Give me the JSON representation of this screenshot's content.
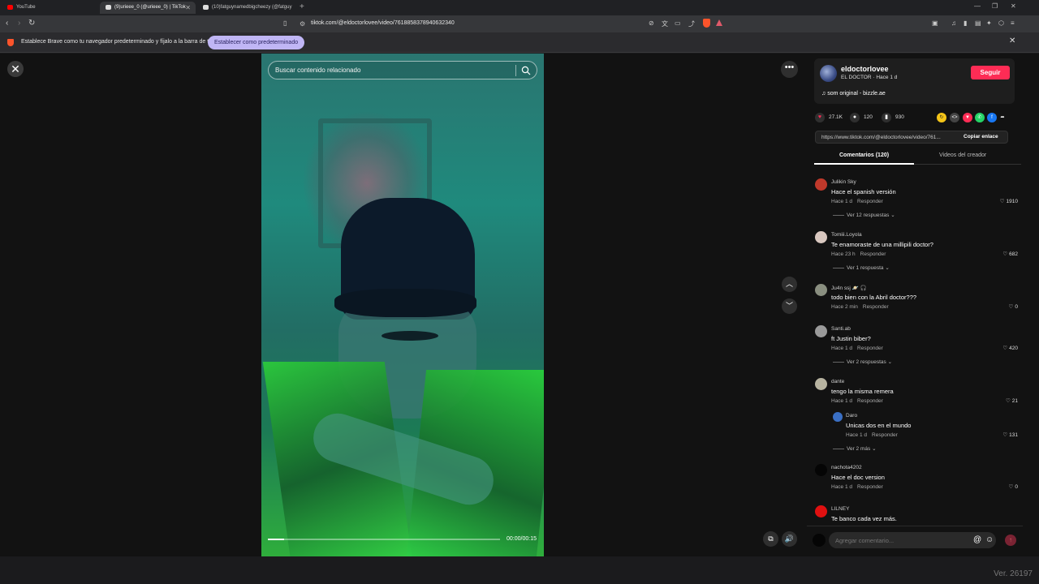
{
  "browser": {
    "tabs": [
      {
        "label": "YouTube",
        "color": "#ff0000"
      },
      {
        "label": "(9)urieee_0 (@urieee_0) | TikTok",
        "color": "#ffffff"
      },
      {
        "label": "(10)fatguynamedbigcheezy (@fatguy",
        "color": "#ffffff"
      }
    ],
    "new_tab": "+",
    "url": "tiktok.com/@eldoctorlovee/video/7618858378940632340",
    "infobar": {
      "message": "Establece Brave como tu navegador predeterminado y fíjalo a la barra de tareas",
      "button": "Establecer como predeterminado"
    }
  },
  "video": {
    "search_placeholder": "Buscar contenido relacionado",
    "time": "00:00/00:15",
    "progress": 0.07
  },
  "post": {
    "author": "eldoctorlovee",
    "author_sub": "EL DOCTOR · Hace 1 d",
    "follow": "Seguir",
    "music": "som original - bizzle.ae",
    "likes": "27.1K",
    "comments": "120",
    "saves": "930",
    "link": "https://www.tiktok.com/@eldoctorlovee/video/761...",
    "copy": "Copiar enlace",
    "tab_comments": "Comentarios (120)",
    "tab_videos": "Videos del creador"
  },
  "comments": [
    {
      "user": "Julikin Sky",
      "text": "Hace el spanish versión",
      "time": "Hace 1 d",
      "reply": "Responder",
      "likes": "1910",
      "view": "Ver 12 respuestas ⌄",
      "avatar": "#c0392b"
    },
    {
      "user": "Tomiii.Loyola",
      "text": "Te enamoraste de una millipili doctor?",
      "time": "Hace 23 h",
      "reply": "Responder",
      "likes": "682",
      "view": "Ver 1 respuesta ⌄",
      "avatar": "#d9c8c0"
    },
    {
      "user": "Ju4n ssj 🪐 🎧",
      "text": "todo bien con la Abril doctor???",
      "time": "Hace 2 min",
      "reply": "Responder",
      "likes": "0",
      "view": "",
      "avatar": "#8a8f80"
    },
    {
      "user": "Santi.ab",
      "text": "ft Justin biber?",
      "time": "Hace 1 d",
      "reply": "Responder",
      "likes": "420",
      "view": "Ver 2 respuestas ⌄",
      "avatar": "#9a9a9a"
    },
    {
      "user": "dante",
      "text": "tengo la misma remera",
      "time": "Hace 1 d",
      "reply": "Responder",
      "likes": "21",
      "view": "",
      "avatar": "#b7b3a0"
    },
    {
      "user": "Daro",
      "text": "Unicas dos en el mundo",
      "time": "Hace 1 d",
      "reply": "Responder",
      "likes": "131",
      "view": "Ver 2 más ⌄",
      "avatar": "#3a6fc4"
    },
    {
      "user": "nachota4202",
      "text": "Hace el doc version",
      "time": "Hace 1 d",
      "reply": "Responder",
      "likes": "0",
      "view": "",
      "avatar": "#050505"
    },
    {
      "user": "LILNEY",
      "text": "Te banco cada vez más.",
      "time": "",
      "reply": "",
      "likes": "",
      "view": "",
      "avatar": "#e01010"
    }
  ],
  "add_comment": {
    "placeholder": "Agregar comentario..."
  },
  "footer": {
    "version": "Ver. 26197"
  }
}
